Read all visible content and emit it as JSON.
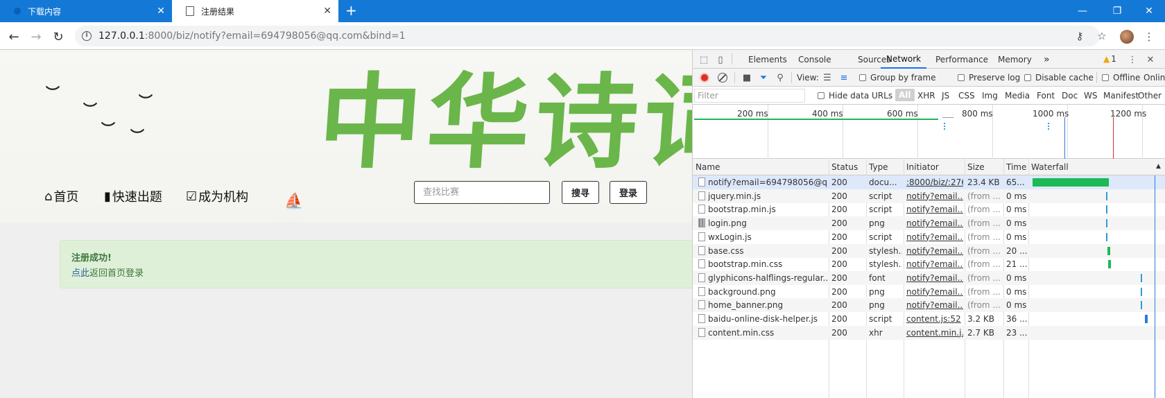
{
  "browser": {
    "tabs": [
      {
        "label": "下载内容",
        "active": false
      },
      {
        "label": "注册结果",
        "active": true
      }
    ],
    "address": {
      "host": "127.0.0.1",
      "rest": ":8000/biz/notify?email=694798056@qq.com&bind=1"
    },
    "window_controls": {
      "minimize": "—",
      "restore": "❐",
      "close": "✕"
    }
  },
  "page": {
    "calligraphy": "中华诗词",
    "nav": [
      {
        "label": "首页",
        "icon": "home-icon"
      },
      {
        "label": "快速出题",
        "icon": "book-icon"
      },
      {
        "label": "成为机构",
        "icon": "check-square-icon"
      }
    ],
    "search_placeholder": "查找比赛",
    "search_button": "搜寻",
    "login_button": "登录",
    "alert": {
      "title": "注册成功!",
      "link": "点此",
      "text": "返回首页登录"
    }
  },
  "devtools": {
    "tabs": [
      "Elements",
      "Console",
      "Sources",
      "Network",
      "Performance",
      "Memory"
    ],
    "active_tab": "Network",
    "more_tabs": "»",
    "warnings": "1",
    "toolbar": {
      "view_label": "View:",
      "group_by_frame": "Group by frame",
      "preserve_log": "Preserve log",
      "disable_cache": "Disable cache",
      "offline": "Offline",
      "online": "Online"
    },
    "filter_placeholder": "Filter",
    "hide_data_urls": "Hide data URLs",
    "filter_types": [
      "All",
      "XHR",
      "JS",
      "CSS",
      "Img",
      "Media",
      "Font",
      "Doc",
      "WS",
      "Manifest",
      "Other"
    ],
    "timeline_labels": [
      "200 ms",
      "400 ms",
      "600 ms",
      "800 ms",
      "1000 ms",
      "1200 ms"
    ],
    "columns": [
      "Name",
      "Status",
      "Type",
      "Initiator",
      "Size",
      "Time",
      "Waterfall"
    ],
    "requests": [
      {
        "name": "notify?email=694798056@qq...",
        "status": "200",
        "type": "docu...",
        "initiator": ":8000/biz/:276",
        "size": "23.4 KB",
        "time": "65...",
        "icon": "doc"
      },
      {
        "name": "jquery.min.js",
        "status": "200",
        "type": "script",
        "initiator": "notify?email...",
        "size": "(from ...",
        "time": "0 ms",
        "icon": "doc"
      },
      {
        "name": "bootstrap.min.js",
        "status": "200",
        "type": "script",
        "initiator": "notify?email...",
        "size": "(from ...",
        "time": "0 ms",
        "icon": "doc"
      },
      {
        "name": "login.png",
        "status": "200",
        "type": "png",
        "initiator": "notify?email...",
        "size": "(from ...",
        "time": "0 ms",
        "icon": "img"
      },
      {
        "name": "wxLogin.js",
        "status": "200",
        "type": "script",
        "initiator": "notify?email...",
        "size": "(from ...",
        "time": "0 ms",
        "icon": "doc"
      },
      {
        "name": "base.css",
        "status": "200",
        "type": "stylesh...",
        "initiator": "notify?email...",
        "size": "(from ...",
        "time": "20 ...",
        "icon": "doc"
      },
      {
        "name": "bootstrap.min.css",
        "status": "200",
        "type": "stylesh...",
        "initiator": "notify?email...",
        "size": "(from ...",
        "time": "21 ...",
        "icon": "doc"
      },
      {
        "name": "glyphicons-halflings-regular....",
        "status": "200",
        "type": "font",
        "initiator": "notify?email...",
        "size": "(from ...",
        "time": "0 ms",
        "icon": "doc"
      },
      {
        "name": "background.png",
        "status": "200",
        "type": "png",
        "initiator": "notify?email...",
        "size": "(from ...",
        "time": "0 ms",
        "icon": "doc"
      },
      {
        "name": "home_banner.png",
        "status": "200",
        "type": "png",
        "initiator": "notify?email...",
        "size": "(from ...",
        "time": "0 ms",
        "icon": "doc"
      },
      {
        "name": "baidu-online-disk-helper.js",
        "status": "200",
        "type": "script",
        "initiator": "content.js:52",
        "size": "3.2 KB",
        "time": "36 ...",
        "icon": "doc"
      },
      {
        "name": "content.min.css",
        "status": "200",
        "type": "xhr",
        "initiator": "content.min.j...",
        "size": "2.7 KB",
        "time": "23 ...",
        "icon": "doc"
      }
    ],
    "colors": {
      "accent": "#1a73e8",
      "record": "#d93025",
      "waterfall_green": "#1db954",
      "waterfall_blue": "#2e9bd8"
    }
  }
}
